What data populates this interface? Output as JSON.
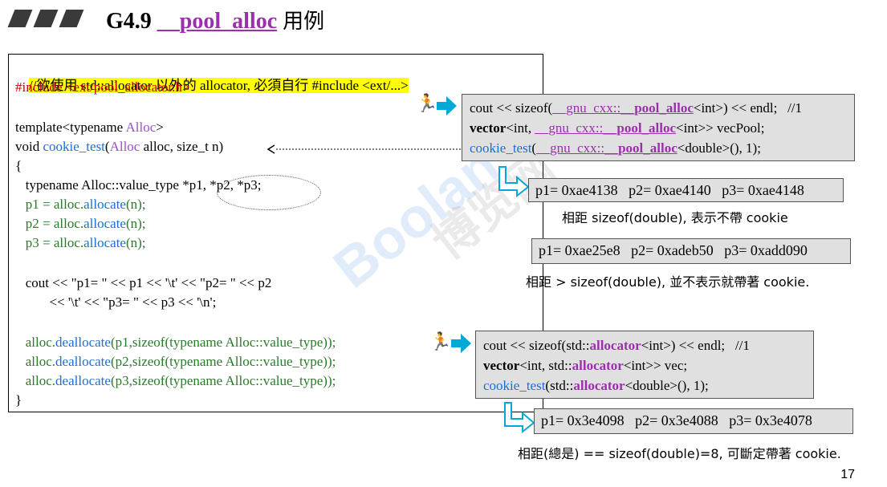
{
  "title": {
    "prefix": "G4.9",
    "func": "__pool_alloc",
    "suffix": "用例"
  },
  "code": {
    "line1": "//欲使用 std::allocator 以外的 allocator, 必須自行 #include <ext/...>",
    "line2": "#include <ext/pool_allocator.h>",
    "line3a": "template<typename ",
    "line3b": "Alloc",
    "line3c": ">",
    "line4a": "void ",
    "line4b": "cookie_test",
    "line4c": "(",
    "line4d": "Alloc",
    "line4e": " alloc, size_t n) ",
    "line5": "{",
    "line6": "   typename Alloc::value_type *p1, *p2, *p3;",
    "line7a": "   p1 = alloc.",
    "line7b": "allocate",
    "line7c": "(n);",
    "line8a": "   p2 = alloc.",
    "line8b": "allocate",
    "line8c": "(n);",
    "line9a": "   p3 = alloc.",
    "line9b": "allocate",
    "line9c": "(n);",
    "line10": "   cout << \"p1= \" << p1 << '\\t' << \"p2= \" << p2",
    "line11": "          << '\\t' << \"p3= \" << p3 << '\\n';",
    "line12a": "   alloc.",
    "line12b": "deallocate",
    "line12c": "(p1,sizeof(typename Alloc::value_type));",
    "line13a": "   alloc.",
    "line13b": "deallocate",
    "line13c": "(p2,sizeof(typename Alloc::value_type));",
    "line14a": "   alloc.",
    "line14b": "deallocate",
    "line14c": "(p3,sizeof(typename Alloc::value_type));",
    "line15": "}"
  },
  "pool_box": {
    "l1a": "cout << sizeof(",
    "l1b": "__gnu_cxx::",
    "l1c": "__pool_alloc",
    "l1d": "<int>) << endl;   //1",
    "l2a": "vector",
    "l2b": "<int, ",
    "l2c": "__gnu_cxx::",
    "l2d": "__pool_alloc",
    "l2e": "<int>> vecPool;",
    "l3a": "cookie_test",
    "l3b": "(",
    "l3c": "__gnu_cxx::",
    "l3d": "__pool_alloc",
    "l3e": "<double>(), 1);"
  },
  "result1": "p1= 0xae4138   p2= 0xae4140   p3= 0xae4148",
  "note1": "相距 sizeof(double), 表示不帶 cookie",
  "result2": "p1= 0xae25e8   p2= 0xadeb50   p3= 0xadd090",
  "note2": "相距 > sizeof(double), 並不表示就帶著 cookie.",
  "std_box": {
    "l1a": "cout << sizeof(std::",
    "l1b": "allocator",
    "l1c": "<int>) << endl;   //1",
    "l2a": "vector",
    "l2b": "<int, std::",
    "l2c": "allocator",
    "l2d": "<int>> vec;",
    "l3a": "cookie_test",
    "l3b": "(std::",
    "l3c": "allocator",
    "l3d": "<double>(), 1);"
  },
  "result3": "p1= 0x3e4098   p2= 0x3e4088   p3= 0x3e4078",
  "note3": "相距(總是) == sizeof(double)=8, 可斷定帶著 cookie.",
  "page_number": "17",
  "watermark": "Boolan",
  "watermark_cjk": "博览网",
  "icons": [
    "running-man-icon",
    "right-arrow-icon",
    "bent-arrow-icon"
  ],
  "colors": {
    "purple": "#9b2fae",
    "blue": "#1a6fd6",
    "green": "#2a7a2a",
    "red": "#cc0000",
    "highlight": "#ffff00",
    "arrow": "#00a9d6"
  }
}
